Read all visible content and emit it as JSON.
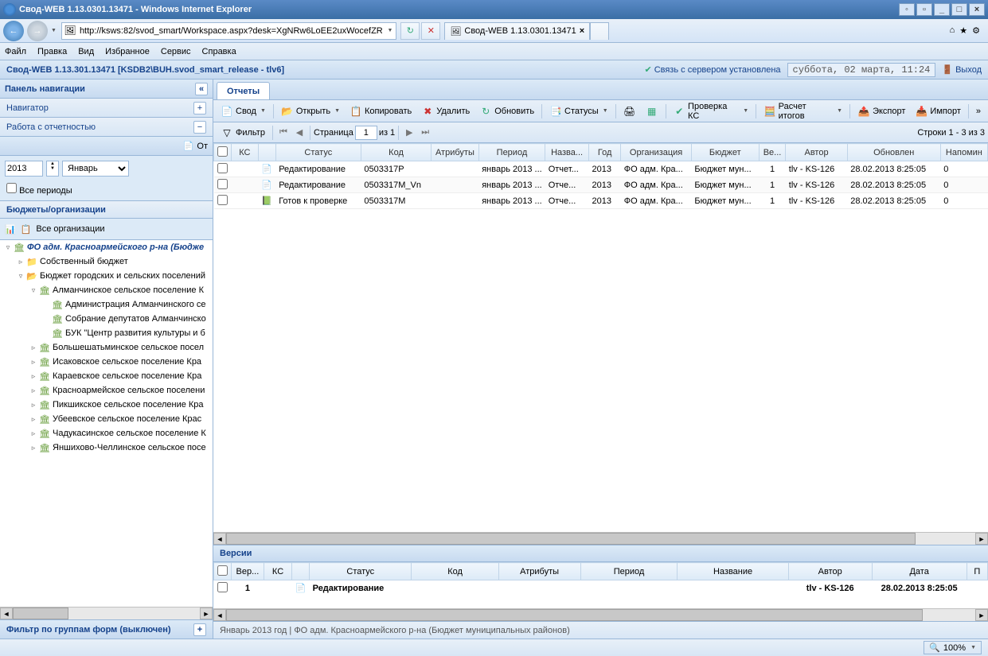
{
  "window": {
    "title": "Свод-WEB 1.13.0301.13471 - Windows Internet Explorer"
  },
  "browser": {
    "url": "http://ksws:82/svod_smart/Workspace.aspx?desk=XgNRw6LoEE2uxWocefZRUw",
    "tab_title": "Свод-WEB 1.13.0301.13471",
    "zoom": "100%"
  },
  "menu": {
    "file": "Файл",
    "edit": "Правка",
    "view": "Вид",
    "favorites": "Избранное",
    "service": "Сервис",
    "help": "Справка"
  },
  "app": {
    "title": "Свод-WEB 1.13.301.13471 [KSDB2\\BUH.svod_smart_release - tlv6]",
    "conn_status": "Связь с сервером установлена",
    "date": "суббота, 02 марта, 11:24",
    "exit": "Выход"
  },
  "sidebar": {
    "nav_panel": "Панель навигации",
    "navigator": "Навигатор",
    "work_reports": "Работа с отчетностью",
    "reports_link": "От",
    "year": "2013",
    "month": "Январь",
    "all_periods": "Все периоды",
    "budgets_orgs": "Бюджеты/организации",
    "all_orgs": "Все организации",
    "tree": [
      {
        "indent": 0,
        "exp": "▿",
        "icon": "🏛",
        "label": "ФО адм. Красноармейского р-на (Бюдже",
        "bold": true
      },
      {
        "indent": 1,
        "exp": "▹",
        "icon": "📁",
        "label": "Собственный бюджет"
      },
      {
        "indent": 1,
        "exp": "▿",
        "icon": "📂",
        "label": "Бюджет городских и сельских поселений"
      },
      {
        "indent": 2,
        "exp": "▿",
        "icon": "🏛",
        "label": "Алманчинское сельское поселение К"
      },
      {
        "indent": 3,
        "exp": "",
        "icon": "🏛",
        "label": "Администрация Алманчинского се"
      },
      {
        "indent": 3,
        "exp": "",
        "icon": "🏛",
        "label": "Собрание депутатов Алманчинско"
      },
      {
        "indent": 3,
        "exp": "",
        "icon": "🏛",
        "label": "БУК \"Центр развития культуры и б"
      },
      {
        "indent": 2,
        "exp": "▹",
        "icon": "🏛",
        "label": "Большешатьминское сельское посел"
      },
      {
        "indent": 2,
        "exp": "▹",
        "icon": "🏛",
        "label": "Исаковское сельское поселение Кра"
      },
      {
        "indent": 2,
        "exp": "▹",
        "icon": "🏛",
        "label": "Караевское сельское поселение Кра"
      },
      {
        "indent": 2,
        "exp": "▹",
        "icon": "🏛",
        "label": "Красноармейское сельское поселени"
      },
      {
        "indent": 2,
        "exp": "▹",
        "icon": "🏛",
        "label": "Пикшикское сельское поселение Кра"
      },
      {
        "indent": 2,
        "exp": "▹",
        "icon": "🏛",
        "label": "Убеевское сельское поселение Крас"
      },
      {
        "indent": 2,
        "exp": "▹",
        "icon": "🏛",
        "label": "Чадукасинское сельское поселение К"
      },
      {
        "indent": 2,
        "exp": "▹",
        "icon": "🏛",
        "label": "Яншихово-Челлинское сельское посе"
      }
    ],
    "filter_footer": "Фильтр по группам форм (выключен)"
  },
  "main": {
    "tab": "Отчеты",
    "toolbar": {
      "svod": "Свод",
      "open": "Открыть",
      "copy": "Копировать",
      "delete": "Удалить",
      "refresh": "Обновить",
      "statuses": "Статусы",
      "check_ks": "Проверка КС",
      "calc_totals": "Расчет итогов",
      "export": "Экспорт",
      "import": "Импорт"
    },
    "paging": {
      "filter": "Фильтр",
      "page_label": "Страница",
      "page": "1",
      "of": "из 1",
      "rows": "Строки 1 - 3 из 3"
    },
    "columns": [
      "",
      "КС",
      "",
      "Статус",
      "Код",
      "Атрибуты",
      "Период",
      "Назва...",
      "Год",
      "Организация",
      "Бюджет",
      "Ве...",
      "Автор",
      "Обновлен",
      "Напомин"
    ],
    "rows": [
      {
        "status": "Редактирование",
        "code": "0503317P",
        "period": "январь 2013 ...",
        "name": "Отчет...",
        "year": "2013",
        "org": "ФО адм. Кра...",
        "budget": "Бюджет мун...",
        "ver": "1",
        "author": "tlv - KS-126",
        "updated": "28.02.2013 8:25:05",
        "remind": "0",
        "status_icon": "📄"
      },
      {
        "status": "Редактирование",
        "code": "0503317M_Vn",
        "period": "январь 2013 ...",
        "name": "Отче...",
        "year": "2013",
        "org": "ФО адм. Кра...",
        "budget": "Бюджет мун...",
        "ver": "1",
        "author": "tlv - KS-126",
        "updated": "28.02.2013 8:25:05",
        "remind": "0",
        "status_icon": "📄"
      },
      {
        "status": "Готов к проверке",
        "code": "0503317M",
        "period": "январь 2013 ...",
        "name": "Отче...",
        "year": "2013",
        "org": "ФО адм. Кра...",
        "budget": "Бюджет мун...",
        "ver": "1",
        "author": "tlv - KS-126",
        "updated": "28.02.2013 8:25:05",
        "remind": "0",
        "status_icon": "📗"
      }
    ],
    "versions": {
      "title": "Версии",
      "columns": [
        "",
        "Вер...",
        "КС",
        "",
        "Статус",
        "Код",
        "Атрибуты",
        "Период",
        "Название",
        "Автор",
        "Дата",
        "П"
      ],
      "row": {
        "ver": "1",
        "status": "Редактирование",
        "author": "tlv - KS-126",
        "date": "28.02.2013 8:25:05"
      }
    },
    "footer": "Январь 2013 год | ФО адм. Красноармейского р-на (Бюджет муниципальных районов)"
  }
}
